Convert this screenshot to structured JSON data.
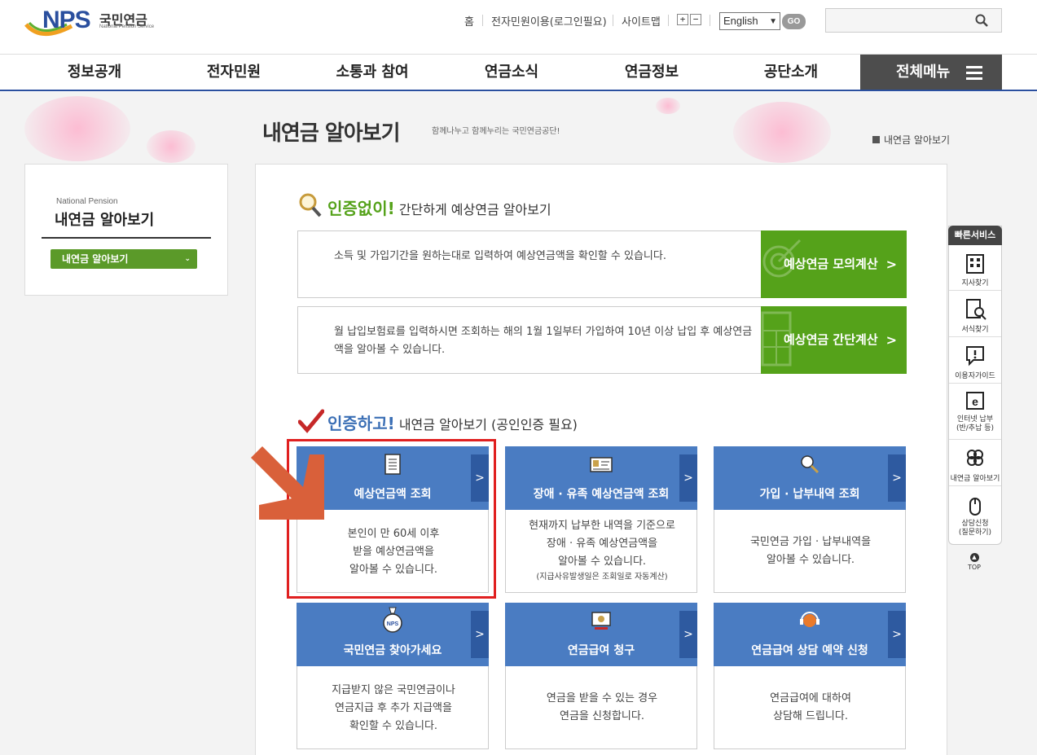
{
  "header": {
    "logo_main": "NPS",
    "logo_kr": "국민연금",
    "logo_en": "National Pension Service",
    "util_links": [
      "홈",
      "전자민원이용(로그인필요)",
      "사이트맵"
    ],
    "zoom_in": "+",
    "zoom_out": "−",
    "language": "English",
    "go_label": "GO",
    "search_value": ""
  },
  "gnb": {
    "items": [
      "정보공개",
      "전자민원",
      "소통과 참여",
      "연금소식",
      "연금정보",
      "공단소개"
    ],
    "all_menu": "전체메뉴"
  },
  "page": {
    "title": "내연금 알아보기",
    "subtitle": "함께나누고 함께누리는 국민연금공단!",
    "breadcrumb": "내연금 알아보기"
  },
  "lnb": {
    "en_title": "National Pension",
    "title": "내연금 알아보기",
    "active_item": "내연금 알아보기"
  },
  "section1": {
    "strong": "인증없이!",
    "rest": " 간단하게 예상연금 알아보기",
    "rows": [
      {
        "desc": "소득 및 가입기간을 원하는대로 입력하여 예상연금액을 확인할 수 있습니다.",
        "button": "예상연금 모의계산"
      },
      {
        "desc": "월 납입보험료를 입력하시면 조회하는 해의 1월 1일부터 가입하여 10년 이상 납입 후 예상연금액을 알아볼 수 있습니다.",
        "button": "예상연금 간단계산"
      }
    ]
  },
  "section2": {
    "strong": "인증하고!",
    "rest": " 내연금 알아보기 (공인인증 필요)",
    "cards": [
      {
        "title": "예상연금액 조회",
        "desc": [
          "본인이 만 60세 이후",
          "받을 예상연금액을",
          "알아볼 수 있습니다."
        ],
        "note": ""
      },
      {
        "title": "장애 · 유족 예상연금액 조회",
        "desc": [
          "현재까지 납부한 내역을 기준으로",
          "장애 · 유족 예상연금액을",
          "알아볼 수 있습니다."
        ],
        "note": "(지급사유발생일은 조회일로 자동계산)"
      },
      {
        "title": "가입 · 납부내역 조회",
        "desc": [
          "국민연금 가입 · 납부내역을",
          "알아볼 수 있습니다."
        ],
        "note": ""
      },
      {
        "title": "국민연금 찾아가세요",
        "desc": [
          "지급받지 않은 국민연금이나",
          "연금지급 후 추가 지급액을",
          "확인할 수 있습니다."
        ],
        "note": ""
      },
      {
        "title": "연금급여 청구",
        "desc": [
          "연금을 받을 수 있는 경우",
          "연금을 신청합니다."
        ],
        "note": ""
      },
      {
        "title": "연금급여 상담 예약 신청",
        "desc": [
          "연금급여에 대하여",
          "상담해 드립니다."
        ],
        "note": ""
      }
    ],
    "icon_nps_label": "NPS"
  },
  "quick": {
    "title": "빠른서비스",
    "items": [
      {
        "label": "지사찾기",
        "label2": ""
      },
      {
        "label": "서식찾기",
        "label2": ""
      },
      {
        "label": "이용자가이드",
        "label2": ""
      },
      {
        "label": "인터넷 납부",
        "label2": "(반/추납 등)"
      },
      {
        "label": "내연금 알아보기",
        "label2": ""
      },
      {
        "label": "상담신청",
        "label2": "(질문하기)"
      }
    ],
    "top": "TOP"
  },
  "colors": {
    "brand_blue": "#2a4f9e",
    "green": "#55a21a",
    "card_blue": "#4a7cc2",
    "highlight_red": "#e02020",
    "arrow_orange": "#d9603a"
  }
}
